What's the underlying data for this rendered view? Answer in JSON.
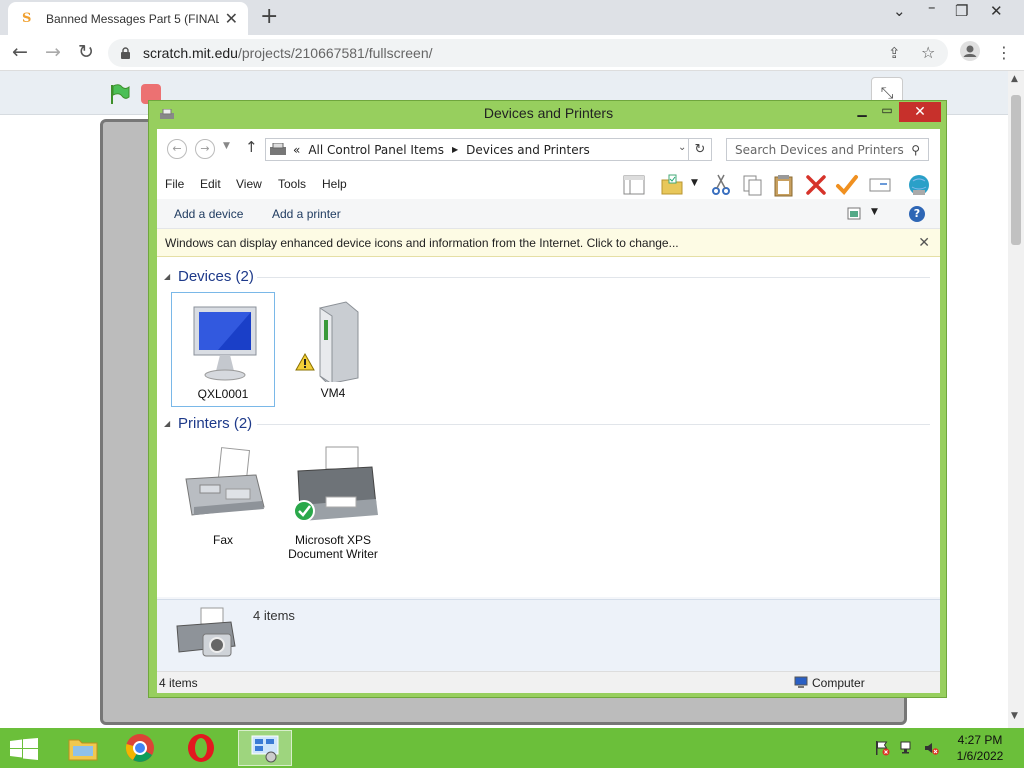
{
  "browser": {
    "tab_title": "Banned Messages Part 5 (FINAL)",
    "url_host": "scratch.mit.edu",
    "url_path": "/projects/210667581/fullscreen/"
  },
  "window": {
    "title": "Devices and Printers",
    "address": {
      "root": "All Control Panel Items",
      "current": "Devices and Printers"
    },
    "search_placeholder": "Search Devices and Printers",
    "menu": [
      "File",
      "Edit",
      "View",
      "Tools",
      "Help"
    ],
    "commands": {
      "add_device": "Add a device",
      "add_printer": "Add a printer"
    },
    "infobar": "Windows can display enhanced device icons and information from the Internet. Click to change...",
    "groups": {
      "devices": {
        "header": "Devices (2)",
        "items": [
          "QXL0001",
          "VM4"
        ]
      },
      "printers": {
        "header": "Printers (2)",
        "items": [
          "Fax",
          "Microsoft XPS Document Writer"
        ]
      }
    },
    "details_count": "4 items",
    "status_count": "4 items",
    "status_location": "Computer"
  },
  "taskbar": {
    "time": "4:27 PM",
    "date": "1/6/2022"
  },
  "colors": {
    "window_frame": "#97cf5e",
    "taskbar": "#6bbf3a",
    "close_button": "#c7302b"
  }
}
